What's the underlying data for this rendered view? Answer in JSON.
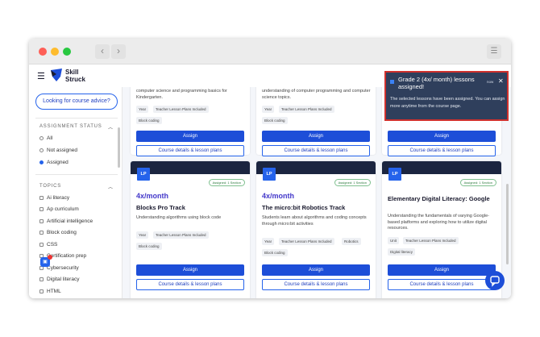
{
  "brand": {
    "logo_line1": "Skill",
    "logo_line2": "Struck"
  },
  "sidebar": {
    "advice_button": "Looking for course advice?",
    "assignment_status": {
      "heading": "ASSIGNMENT STATUS",
      "options": [
        {
          "label": "All",
          "selected": false
        },
        {
          "label": "Not assigned",
          "selected": false
        },
        {
          "label": "Assigned",
          "selected": true
        }
      ]
    },
    "topics": {
      "heading": "TOPICS",
      "items": [
        "Ai literacy",
        "Ap curriculum",
        "Artificial intelligence",
        "Block coding",
        "CSS",
        "Certification prep",
        "Cybersecurity",
        "Digital literacy",
        "HTML"
      ]
    },
    "helper_badge_count": "2"
  },
  "cards_top": [
    {
      "desc": "computer science and programming basics for Kindergarten.",
      "tags_row1": [
        "Year",
        "Teacher Lesson Plans Included"
      ],
      "tags_row2": [
        "Block coding"
      ],
      "assign_label": "Assign",
      "details_label": "Course details & lesson plans"
    },
    {
      "desc": "understanding of computer programming and computer science topics.",
      "tags_row1": [
        "Year",
        "Teacher Lesson Plans Included"
      ],
      "tags_row2": [
        "Block coding"
      ],
      "assign_label": "Assign",
      "details_label": "Course details & lesson plans"
    },
    {
      "assign_label": "Assign",
      "details_label": "Course details & lesson plans"
    }
  ],
  "cards_bottom": [
    {
      "lp": "LP",
      "status": "Assigned: 1 Section",
      "frequency": "4x/month",
      "title": "Blocks Pro Track",
      "desc": "Understanding algorithms using block code",
      "tags_row1": [
        "Year",
        "Teacher Lesson Plans Included"
      ],
      "tags_row2": [
        "Block coding"
      ],
      "assign_label": "Assign",
      "details_label": "Course details & lesson plans"
    },
    {
      "lp": "LP",
      "status": "Assigned: 1 Section",
      "frequency": "4x/month",
      "title": "The micro:bit Robotics Track",
      "desc": "Students learn about algorithms and coding concepts through micro:bit activities",
      "tags_row1": [
        "Year",
        "Teacher Lesson Plans Included",
        "Robotics"
      ],
      "tags_row2": [
        "Block coding"
      ],
      "assign_label": "Assign",
      "details_label": "Course details & lesson plans"
    },
    {
      "lp": "LP",
      "status": "Assigned: 1 Section",
      "frequency": "",
      "title": "Elementary Digital Literacy: Google",
      "desc": "Understanding the fundamentals of varying Google-based platforms and exploring how to utilize digital resources.",
      "tags_row1": [
        "Unit",
        "Teacher Lesson Plans Included"
      ],
      "tags_row2": [
        "Digital literacy"
      ],
      "assign_label": "Assign",
      "details_label": "Course details & lesson plans"
    }
  ],
  "toast": {
    "title": "Grade 2 (4x/ month) lessons assigned!",
    "time": "now",
    "close": "✕",
    "message": "The selected lessons have been assigned. You can assign more anytime from the course page."
  },
  "colors": {
    "accent": "#2563eb",
    "hero": "#1b2540",
    "highlight": "#d0312d"
  }
}
